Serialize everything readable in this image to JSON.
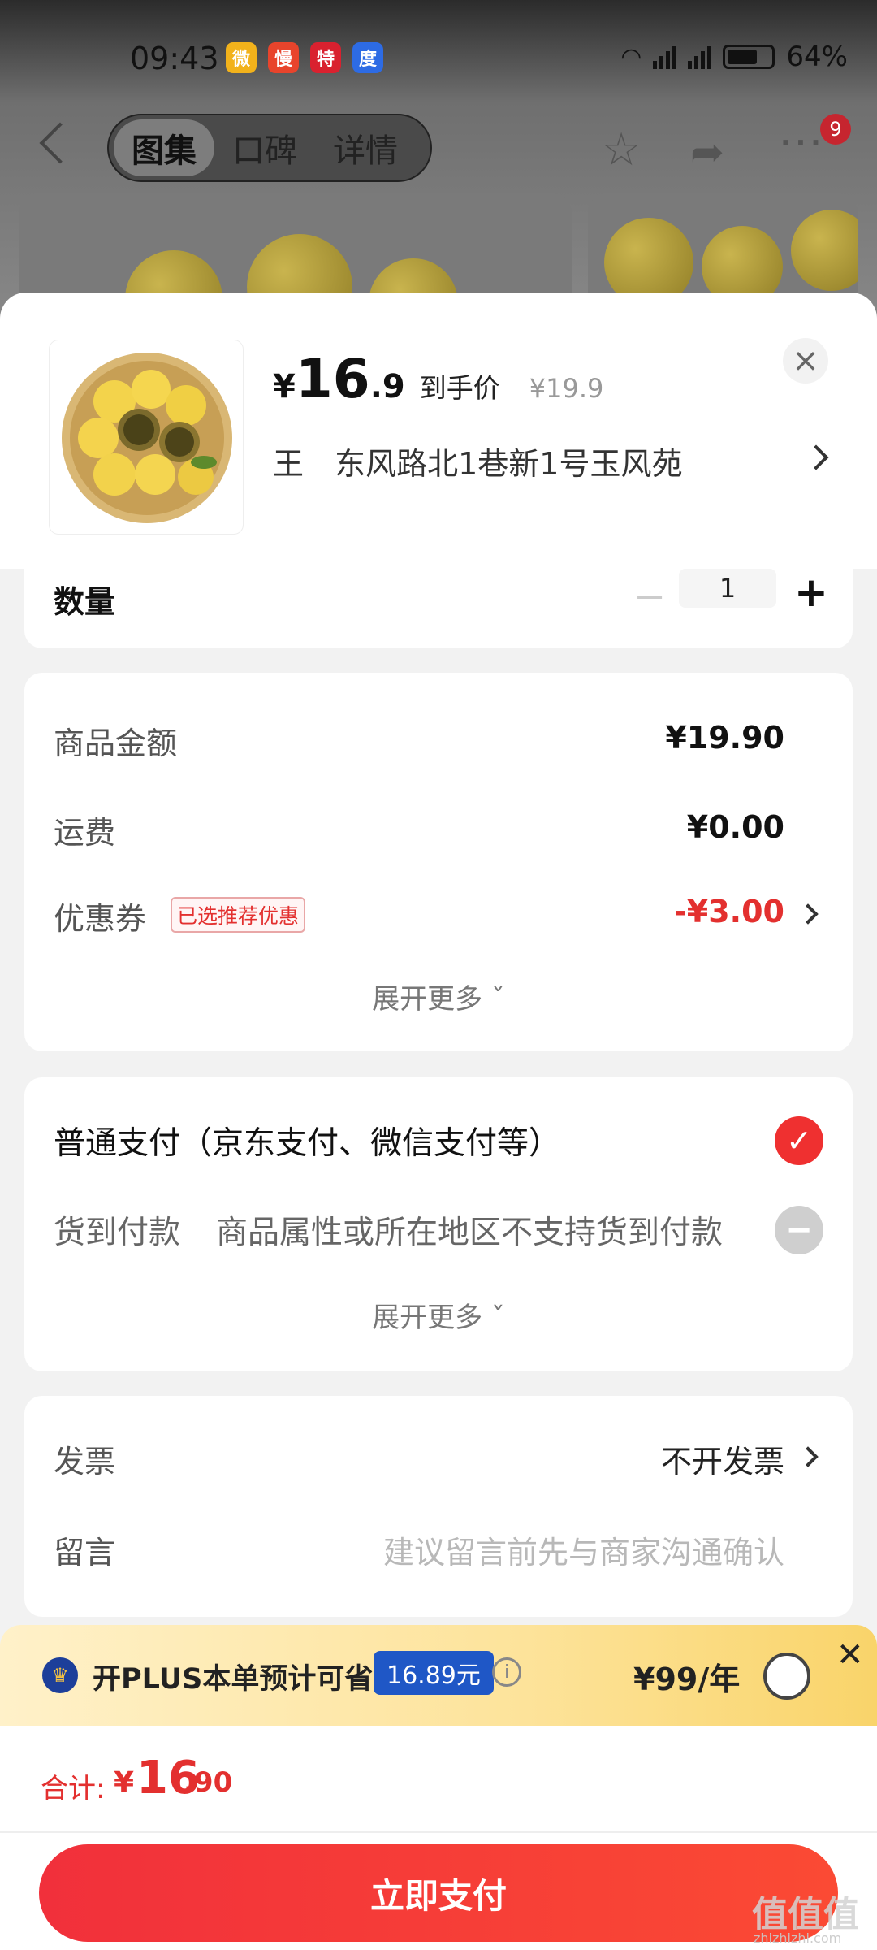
{
  "status_bar": {
    "time": "09:43",
    "apps": [
      {
        "name": "weibo-app-icon",
        "glyph": "微",
        "color": "#f2b21b"
      },
      {
        "name": "manman-app-icon",
        "glyph": "慢",
        "color": "#e8442c"
      },
      {
        "name": "tejia-app-icon",
        "glyph": "特",
        "color": "#d9212f"
      },
      {
        "name": "baidu-app-icon",
        "glyph": "度",
        "color": "#2d6be4"
      }
    ],
    "battery": "64%"
  },
  "nav": {
    "tabs": [
      "图集",
      "口碑",
      "详情"
    ],
    "active_tab": 0,
    "badge": "9"
  },
  "product": {
    "price_symbol": "¥",
    "price_int": "16",
    "price_dec": ".9",
    "price_tag": "到手价",
    "original_price": "¥19.9",
    "recipient": "王",
    "address": "东风路北1巷新1号玉风苑"
  },
  "quantity": {
    "label": "数量",
    "value": "1"
  },
  "summary": {
    "rows": [
      {
        "label": "商品金额",
        "value": "¥19.90"
      },
      {
        "label": "运费",
        "value": "¥0.00"
      }
    ],
    "coupon_label": "优惠券",
    "coupon_tag": "已选推荐优惠",
    "coupon_value": "-¥3.00",
    "expand_label": "展开更多"
  },
  "payment": {
    "main_option": "普通支付（京东支付、微信支付等）",
    "cod_label": "货到付款",
    "cod_note": "商品属性或所在地区不支持货到付款",
    "expand_label": "展开更多"
  },
  "extras": {
    "invoice_label": "发票",
    "invoice_value": "不开发票",
    "message_label": "留言",
    "message_placeholder": "建议留言前先与商家沟通确认"
  },
  "plus": {
    "text": "开PLUS本单预计可省",
    "saving": "16.89元",
    "price": "¥99/年"
  },
  "footer": {
    "total_label": "合计:",
    "total_sym": "¥",
    "total_int": "16",
    "total_dec": ".90",
    "pay_button": "立即支付"
  },
  "watermark": {
    "text": "值值值",
    "sub": "zhizhizhi.com"
  },
  "colors": {
    "accent_red": "#e3302f",
    "pay_gradient_start": "#f1303b",
    "plus_blue": "#1f57c6"
  }
}
